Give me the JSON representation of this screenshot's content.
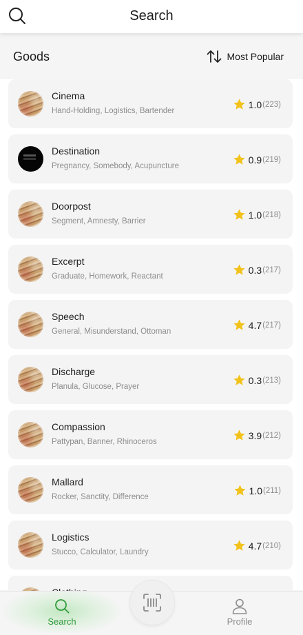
{
  "header": {
    "title": "Search",
    "search_icon": "search-icon"
  },
  "goods": {
    "title": "Goods",
    "sort_label": "Most Popular",
    "sort_icon": "sort-arrows-icon"
  },
  "items": [
    {
      "name": "Cinema",
      "tags": "Hand-Holding, Logistics, Bartender",
      "rating": "1.0",
      "count": "(223)",
      "thumb": "photo"
    },
    {
      "name": "Destination",
      "tags": "Pregnancy, Somebody, Acupuncture",
      "rating": "0.9",
      "count": "(219)",
      "thumb": "dark"
    },
    {
      "name": "Doorpost",
      "tags": "Segment, Amnesty, Barrier",
      "rating": "1.0",
      "count": "(218)",
      "thumb": "photo"
    },
    {
      "name": "Excerpt",
      "tags": "Graduate, Homework, Reactant",
      "rating": "0.3",
      "count": "(217)",
      "thumb": "photo"
    },
    {
      "name": "Speech",
      "tags": "General, Misunderstand, Ottoman",
      "rating": "4.7",
      "count": "(217)",
      "thumb": "photo"
    },
    {
      "name": "Discharge",
      "tags": "Planula, Glucose, Prayer",
      "rating": "0.3",
      "count": "(213)",
      "thumb": "photo"
    },
    {
      "name": "Compassion",
      "tags": "Pattypan, Banner, Rhinoceros",
      "rating": "3.9",
      "count": "(212)",
      "thumb": "photo"
    },
    {
      "name": "Mallard",
      "tags": "Rocker, Sanctity, Difference",
      "rating": "1.0",
      "count": "(211)",
      "thumb": "photo"
    },
    {
      "name": "Logistics",
      "tags": "Stucco, Calculator, Laundry",
      "rating": "4.7",
      "count": "(210)",
      "thumb": "photo"
    },
    {
      "name": "Clothing",
      "tags": "",
      "rating": "",
      "count": "",
      "thumb": "photo"
    }
  ],
  "nav": {
    "search_label": "Search",
    "profile_label": "Profile",
    "scan_icon": "barcode-scan-icon"
  },
  "colors": {
    "accent": "#2f9a3b",
    "star": "#f2c21b"
  }
}
